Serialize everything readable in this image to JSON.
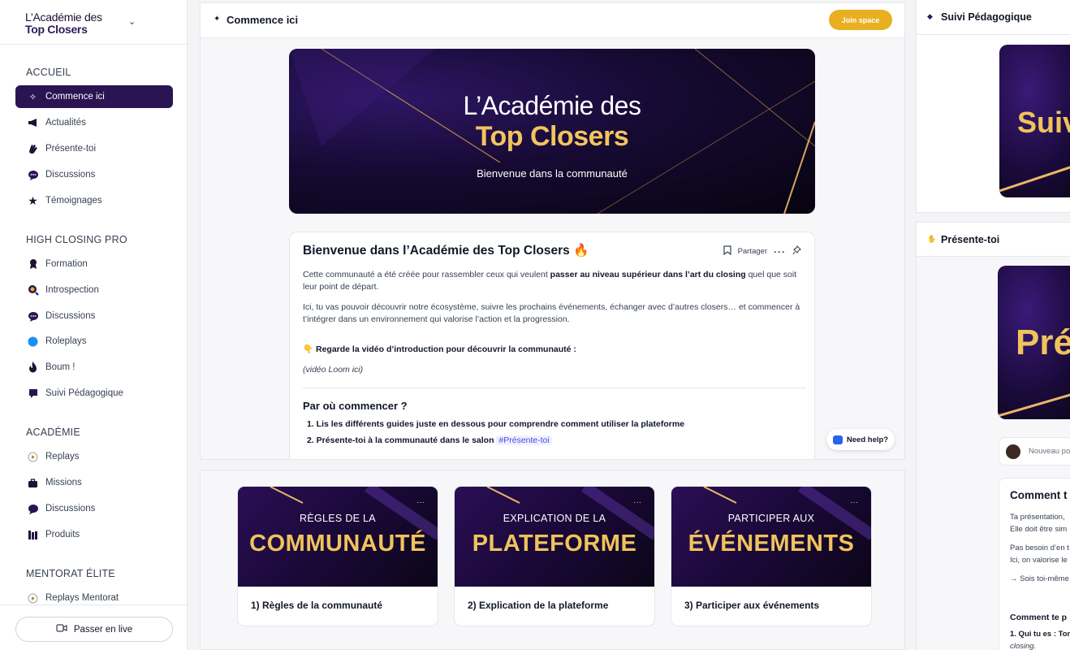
{
  "brand": {
    "line1": "L’Académie des",
    "line2": "Top Closers"
  },
  "sidebar": {
    "sections": [
      {
        "title": "ACCUEIL",
        "items": [
          {
            "label": "Commence ici",
            "icon": "pin-icon",
            "active": true
          },
          {
            "label": "Actualités",
            "icon": "megaphone-icon"
          },
          {
            "label": "Présente-toi",
            "icon": "wave-hand-icon"
          },
          {
            "label": "Discussions",
            "icon": "chat-bubble-icon"
          },
          {
            "label": "Témoignages",
            "icon": "star-icon"
          }
        ]
      },
      {
        "title": "HIGH CLOSING PRO",
        "items": [
          {
            "label": "Formation",
            "icon": "medal-icon"
          },
          {
            "label": "Introspection",
            "icon": "magnifier-icon"
          },
          {
            "label": "Discussions",
            "icon": "chat-bubble-icon"
          },
          {
            "label": "Roleplays",
            "icon": "blue-circle-icon"
          },
          {
            "label": "Boum !",
            "icon": "flame-icon"
          },
          {
            "label": "Suivi Pédagogique",
            "icon": "bookmark-icon"
          }
        ]
      },
      {
        "title": "ACADÉMIE",
        "items": [
          {
            "label": "Replays",
            "icon": "play-icon"
          },
          {
            "label": "Missions",
            "icon": "briefcase-icon"
          },
          {
            "label": "Discussions",
            "icon": "speech-icon"
          },
          {
            "label": "Produits",
            "icon": "books-icon"
          }
        ]
      },
      {
        "title": "MENTORAT ÉLITE",
        "items": [
          {
            "label": "Replays Mentorat",
            "icon": "play-icon"
          }
        ]
      }
    ],
    "live_button": "Passer en live"
  },
  "main": {
    "title": "Commence ici",
    "join_button": "Join space",
    "hero": {
      "line1": "L’Académie des",
      "line2": "Top Closers",
      "subtitle": "Bienvenue dans la communauté"
    },
    "post": {
      "title": "Bienvenue dans l’Académie des Top Closers 🔥",
      "share_label": "Partager",
      "p1_a": "Cette communauté a été créée pour rassembler ceux qui veulent ",
      "p1_b": "passer au niveau supérieur dans l’art du closing",
      "p1_c": " quel que soit leur point de départ.",
      "p2": "Ici, tu vas pouvoir découvrir notre écosystème, suivre les prochains événements, échanger avec d’autres closers… et commencer à t’intégrer dans un environnement qui valorise l’action et la progression.",
      "p3": "👇 Regarde la vidéo d’introduction pour découvrir la communauté :",
      "p4": "(vidéo Loom ici)",
      "h2": "Par où commencer ?",
      "list1": "1. Lis les différents guides juste en dessous pour comprendre comment utiliser la plateforme",
      "list2_a": "2. Présente-toi à la communauté dans le salon ",
      "list2_tag": "#Présente-toi"
    },
    "need_help": "Need help?"
  },
  "cards": [
    {
      "img_small": "RÈGLES DE LA",
      "img_large": "COMMUNAUTÉ",
      "label": "1) Règles de la communauté"
    },
    {
      "img_small": "EXPLICATION DE LA",
      "img_large": "PLATEFORME",
      "label": "2) Explication de la plateforme"
    },
    {
      "img_small": "PARTICIPER AUX",
      "img_large": "ÉVÉNEMENTS",
      "label": "3) Participer aux événements"
    }
  ],
  "right": {
    "panel1_title": "Suivi Pédagogique",
    "panel1_img_text": "Suiv",
    "panel2_title": "Présente-toi",
    "panel2_img_text": "Pré",
    "new_post_placeholder": "Nouveau po",
    "post_title": "Comment t",
    "lines": [
      "Ta présentation,",
      "Elle doit être sim",
      "Pas besoin d’en t",
      "Ici, on valorise le",
      "→ Sois toi-même",
      "Comment te p",
      "1. Qui tu es : Ton",
      "closing."
    ]
  },
  "colors": {
    "accent_purple": "#2b1452",
    "gold": "#e8b020",
    "hero_gold": "#f2c45f"
  }
}
